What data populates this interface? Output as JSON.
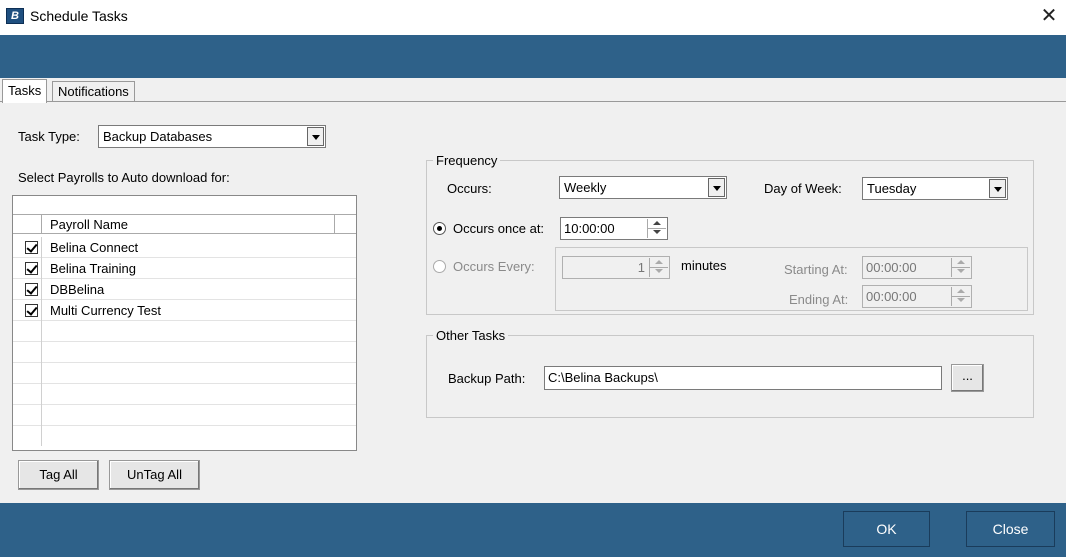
{
  "window": {
    "title": "Schedule Tasks",
    "icon": "app-logo-icon",
    "close_glyph": "✕"
  },
  "tabs": [
    {
      "label": "Tasks",
      "active": true
    },
    {
      "label": "Notifications",
      "active": false
    }
  ],
  "task_type": {
    "label": "Task Type:",
    "value": "Backup Databases"
  },
  "payrolls": {
    "label": "Select Payrolls to Auto download for:",
    "column_header": "Payroll Name",
    "rows": [
      {
        "name": "Belina Connect",
        "checked": true
      },
      {
        "name": "Belina Training",
        "checked": true
      },
      {
        "name": "DBBelina",
        "checked": true
      },
      {
        "name": "Multi Currency Test",
        "checked": true
      }
    ],
    "tag_all_label": "Tag All",
    "untag_all_label": "UnTag All"
  },
  "frequency": {
    "title": "Frequency",
    "occurs_label": "Occurs:",
    "occurs_value": "Weekly",
    "day_of_week_label": "Day of Week:",
    "day_of_week_value": "Tuesday",
    "once_label": "Occurs once at:",
    "once_value": "10:00:00",
    "every_label": "Occurs Every:",
    "every_value": "1",
    "minutes_label": "minutes",
    "starting_label": "Starting At:",
    "starting_value": "00:00:00",
    "ending_label": "Ending At:",
    "ending_value": "00:00:00"
  },
  "other_tasks": {
    "title": "Other Tasks",
    "backup_path_label": "Backup Path:",
    "backup_path_value": "C:\\Belina Backups\\",
    "browse_label": "..."
  },
  "footer": {
    "ok_label": "OK",
    "close_label": "Close"
  },
  "colors": {
    "band": "#2e6189",
    "panel": "#f0f0f0"
  }
}
